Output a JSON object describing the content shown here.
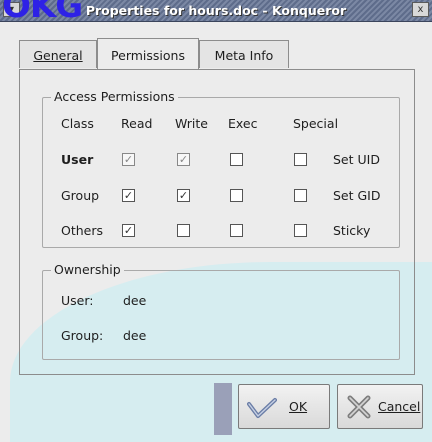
{
  "window": {
    "title": "Properties for hours.doc - Konqueror",
    "overlay_text": "OKG",
    "menu_glyph": "▾",
    "close_glyph": "x"
  },
  "tabs": [
    {
      "label": "General",
      "active": false
    },
    {
      "label": "Permissions",
      "active": true
    },
    {
      "label": "Meta Info",
      "active": false
    }
  ],
  "access_permissions": {
    "title": "Access Permissions",
    "headers": {
      "class": "Class",
      "read": "Read",
      "write": "Write",
      "exec": "Exec",
      "special": "Special"
    },
    "rows": [
      {
        "class": "User",
        "read": true,
        "write": true,
        "exec": false,
        "special": false,
        "special_label": "Set UID",
        "read_enabled": false,
        "write_enabled": false
      },
      {
        "class": "Group",
        "read": true,
        "write": true,
        "exec": false,
        "special": false,
        "special_label": "Set GID",
        "read_enabled": true,
        "write_enabled": true
      },
      {
        "class": "Others",
        "read": true,
        "write": false,
        "exec": false,
        "special": false,
        "special_label": "Sticky",
        "read_enabled": true,
        "write_enabled": true
      }
    ]
  },
  "ownership": {
    "title": "Ownership",
    "user_label": "User:",
    "user_value": "dee",
    "group_label": "Group:",
    "group_value": "dee"
  },
  "buttons": {
    "ok_label": "OK",
    "cancel_label": "Cancel"
  },
  "colors": {
    "title_bar": "#5e6c8b",
    "overlay_logo": "#2e22e6",
    "background_band": "#d6edf0"
  },
  "icons": {
    "ok": "checkmark-icon",
    "cancel": "cancel-x-icon"
  }
}
